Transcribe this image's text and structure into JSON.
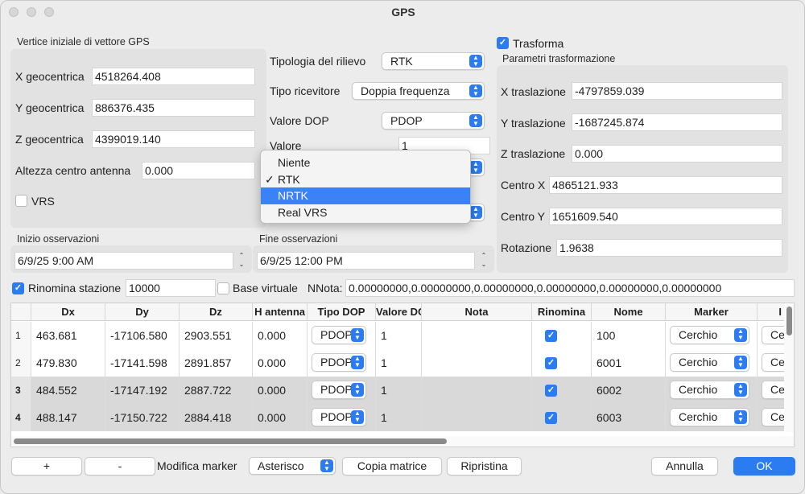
{
  "window": {
    "title": "GPS"
  },
  "left_group": {
    "title": "Vertice iniziale di vettore GPS",
    "x_label": "X geocentrica",
    "x_value": "4518264.408",
    "y_label": "Y geocentrica",
    "y_value": "886376.435",
    "z_label": "Z geocentrica",
    "z_value": "4399019.140",
    "antenna_label": "Altezza centro antenna",
    "antenna_value": "0.000",
    "vrs_label": "VRS"
  },
  "middle": {
    "survey_type_label": "Tipologia del rilievo",
    "survey_type_value": "RTK",
    "receiver_label": "Tipo ricevitore",
    "receiver_value": "Doppia frequenza",
    "dop_label": "Valore DOP",
    "dop_value": "PDOP",
    "valore_label": "Valore",
    "valore_value": "1",
    "menu_items": [
      {
        "label": "Niente",
        "checked": false,
        "selected": false
      },
      {
        "label": "RTK",
        "checked": true,
        "selected": false
      },
      {
        "label": "NRTK",
        "checked": false,
        "selected": true
      },
      {
        "label": "Real VRS",
        "checked": false,
        "selected": false
      }
    ],
    "check_mark": "✓"
  },
  "observations": {
    "start_label": "Inizio osservazioni",
    "start_value": "6/9/25 9:00 AM",
    "end_label": "Fine osservazioni",
    "end_value": "6/9/25 12:00 PM"
  },
  "transform": {
    "checkbox_label": "Trasforma",
    "group_title": "Parametri trasformazione",
    "tx_label": "X traslazione",
    "tx_value": "-4797859.039",
    "ty_label": "Y traslazione",
    "ty_value": "-1687245.874",
    "tz_label": "Z traslazione",
    "tz_value": "0.000",
    "cx_label": "Centro X",
    "cx_value": "4865121.933",
    "cy_label": "Centro Y",
    "cy_value": "1651609.540",
    "rot_label": "Rotazione",
    "rot_value": "1.9638"
  },
  "options_row": {
    "rename_label": "Rinomina stazione",
    "rename_value": "10000",
    "virtual_base_label": "Base virtuale",
    "note_label": "NNota:",
    "note_value": "0.00000000,0.00000000,0.00000000,0.00000000,0.00000000,0.00000000"
  },
  "table": {
    "headers": [
      "Dx",
      "Dy",
      "Dz",
      "H antenna",
      "Tipo DOP",
      "Valore DOP",
      "Nota",
      "Rinomina",
      "Nome",
      "Marker",
      "I"
    ],
    "rows": [
      {
        "num": "1",
        "dx": "463.681",
        "dy": "-17106.580",
        "dz": "2903.551",
        "h": "0.000",
        "dop": "PDOP",
        "val": "1",
        "nota": "",
        "nome": "100",
        "marker": "Cerchio",
        "extra": "Ce"
      },
      {
        "num": "2",
        "dx": "479.830",
        "dy": "-17141.598",
        "dz": "2891.857",
        "h": "0.000",
        "dop": "PDOP",
        "val": "1",
        "nota": "",
        "nome": "6001",
        "marker": "Cerchio",
        "extra": "Ce"
      },
      {
        "num": "3",
        "dx": "484.552",
        "dy": "-17147.192",
        "dz": "2887.722",
        "h": "0.000",
        "dop": "PDOP",
        "val": "1",
        "nota": "",
        "nome": "6002",
        "marker": "Cerchio",
        "extra": "Ce"
      },
      {
        "num": "4",
        "dx": "488.147",
        "dy": "-17150.722",
        "dz": "2884.418",
        "h": "0.000",
        "dop": "PDOP",
        "val": "1",
        "nota": "",
        "nome": "6003",
        "marker": "Cerchio",
        "extra": "Ce"
      }
    ]
  },
  "bottom": {
    "plus_label": "+",
    "minus_label": "-",
    "marker_label": "Modifica marker",
    "marker_value": "Asterisco",
    "copy_label": "Copia matrice",
    "restore_label": "Ripristina",
    "cancel_label": "Annulla",
    "ok_label": "OK"
  },
  "colors": {
    "accent": "#2b7cf0",
    "selection": "#3b82f6",
    "selected_row": "#d9d9d9"
  }
}
